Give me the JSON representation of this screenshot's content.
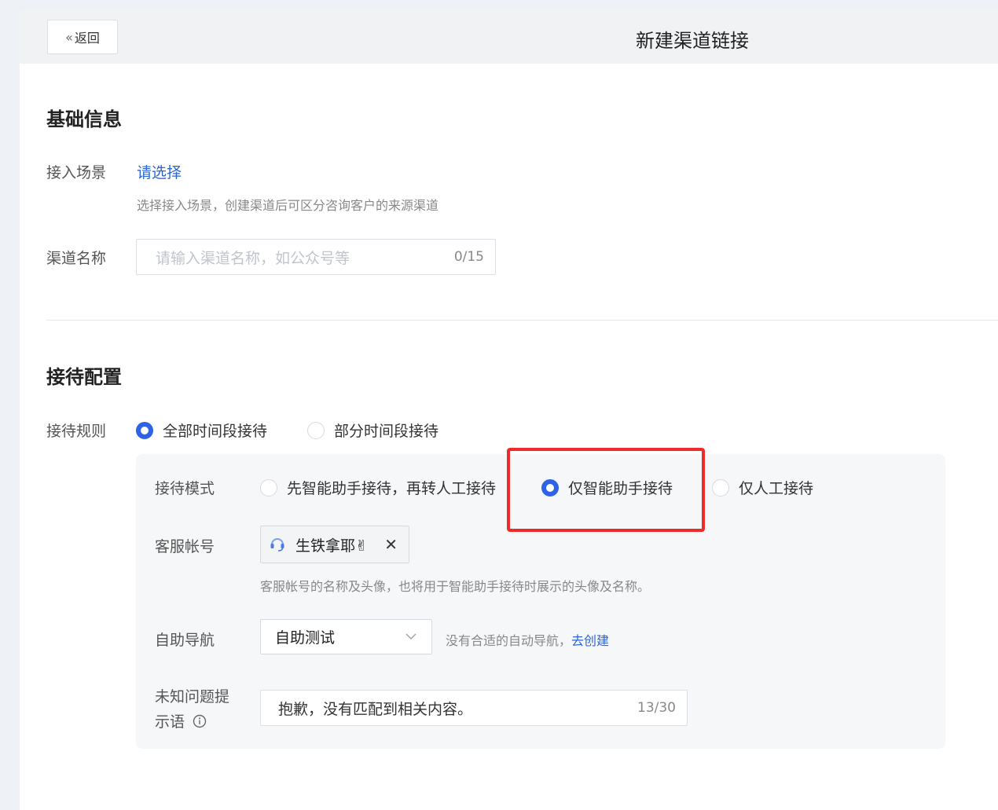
{
  "header": {
    "back_label": "返回",
    "title": "新建渠道链接"
  },
  "basic": {
    "section_title": "基础信息",
    "scene_label": "接入场景",
    "scene_link": "请选择",
    "scene_hint": "选择接入场景，创建渠道后可区分咨询客户的来源渠道",
    "name_label": "渠道名称",
    "name_placeholder": "请输入渠道名称，如公众号等",
    "name_count": "0/15"
  },
  "reception": {
    "section_title": "接待配置",
    "rule_label": "接待规则",
    "rule_options": [
      "全部时间段接待",
      "部分时间段接待"
    ],
    "rule_selected": "全部时间段接待",
    "mode_label": "接待模式",
    "mode_options": [
      "先智能助手接待，再转人工接待",
      "仅智能助手接待",
      "仅人工接待"
    ],
    "mode_selected": "仅智能助手接待",
    "account_label": "客服帐号",
    "account_tag": "生铁拿耶✌",
    "account_hint": "客服帐号的名称及头像，也将用于智能助手接待时展示的头像及名称。",
    "nav_label": "自助导航",
    "nav_value": "自助测试",
    "nav_hint": "没有合适的自动导航，",
    "nav_link": "去创建",
    "unknown_label_line1": "未知问题提",
    "unknown_label_line2": "示语",
    "unknown_value": "抱歉，没有匹配到相关内容。",
    "unknown_count": "13/30"
  },
  "colors": {
    "accent": "#2d63e4",
    "link": "#2b66d6",
    "highlight": "#f02a2a"
  }
}
